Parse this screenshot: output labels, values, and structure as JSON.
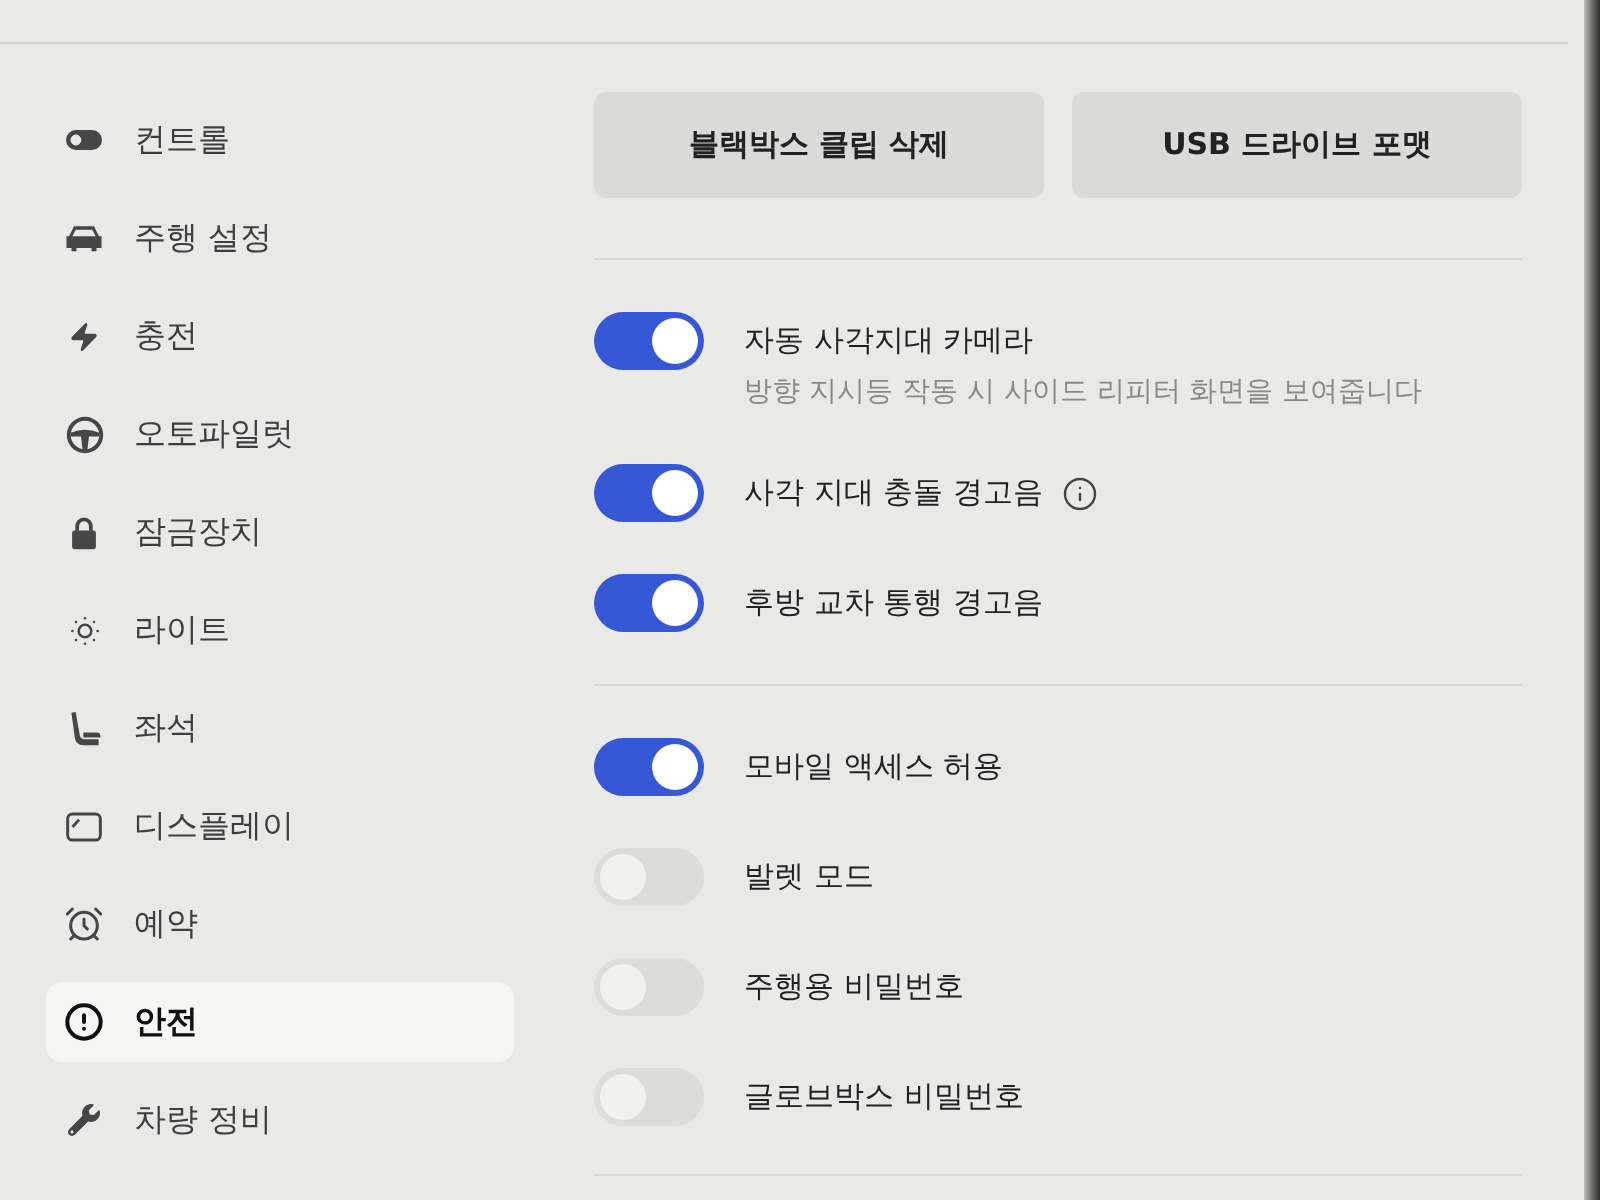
{
  "sidebar": {
    "items": [
      {
        "label": "컨트롤",
        "selected": false
      },
      {
        "label": "주행 설정",
        "selected": false
      },
      {
        "label": "충전",
        "selected": false
      },
      {
        "label": "오토파일럿",
        "selected": false
      },
      {
        "label": "잠금장치",
        "selected": false
      },
      {
        "label": "라이트",
        "selected": false
      },
      {
        "label": "좌석",
        "selected": false
      },
      {
        "label": "디스플레이",
        "selected": false
      },
      {
        "label": "예약",
        "selected": false
      },
      {
        "label": "안전",
        "selected": true
      },
      {
        "label": "차량 정비",
        "selected": false
      }
    ]
  },
  "buttons": [
    "블랙박스 클립 삭제",
    "USB 드라이브 포맷"
  ],
  "sections": [
    {
      "toggles": [
        {
          "title": "자동 사각지대 카메라",
          "subtitle": "방향 지시등 작동 시 사이드 리피터 화면을 보여줍니다",
          "on": true,
          "info": false
        },
        {
          "title": "사각 지대 충돌 경고음",
          "on": true,
          "info": true
        },
        {
          "title": "후방 교차 통행 경고음",
          "on": true,
          "info": false
        }
      ]
    },
    {
      "toggles": [
        {
          "title": "모바일 액세스 허용",
          "on": true,
          "info": false
        },
        {
          "title": "발렛 모드",
          "on": false,
          "info": false
        },
        {
          "title": "주행용 비밀번호",
          "on": false,
          "info": false
        },
        {
          "title": "글로브박스 비밀번호",
          "on": false,
          "info": false
        }
      ]
    }
  ]
}
